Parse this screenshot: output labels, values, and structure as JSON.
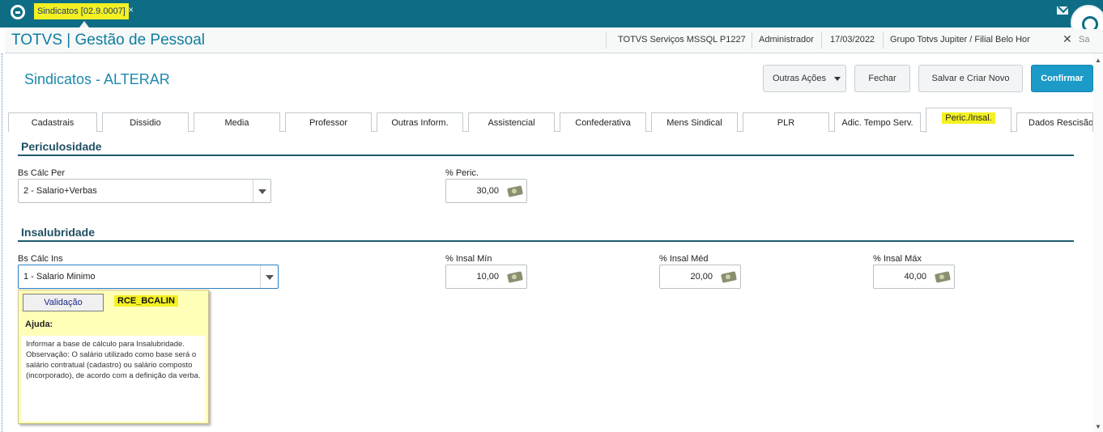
{
  "topbar": {
    "tab_label": "Sindicatos [02.9.0007]",
    "tab_close": "×"
  },
  "app": {
    "title": "TOTVS | Gestão de Pessoal",
    "env": "TOTVS Serviços MSSQL P1227",
    "user": "Administrador",
    "date": "17/03/2022",
    "branch": "Grupo Totvs Jupiter / Filial Belo Hor",
    "close_icon": "✕",
    "close_label": "Sa"
  },
  "form": {
    "title": "Sindicatos - ALTERAR",
    "buttons": {
      "outras": "Outras Ações",
      "fechar": "Fechar",
      "salvar": "Salvar e Criar Novo",
      "confirmar": "Confirmar"
    }
  },
  "tabs": [
    "Cadastrais",
    "Dissidio",
    "Media",
    "Professor",
    "Outras Inform.",
    "Assistencial",
    "Confederativa",
    "Mens Sindical",
    "PLR",
    "Adic. Tempo Serv.",
    "Peric./Insal.",
    "Dados Rescisão"
  ],
  "periculosidade": {
    "title": "Periculosidade",
    "bs_label": "Bs Cálc Per",
    "bs_value": "2 - Salario+Verbas",
    "perc_label": "% Peric.",
    "perc_value": "30,00"
  },
  "insalubridade": {
    "title": "Insalubridade",
    "bs_label": "Bs Cálc Ins",
    "bs_value": "1 - Salario Minimo",
    "min_label": "% Insal Mín",
    "min_value": "10,00",
    "med_label": "% Insal Méd",
    "med_value": "20,00",
    "max_label": "% Insal Máx",
    "max_value": "40,00"
  },
  "tooltip": {
    "validacao": "Validação",
    "code": "RCE_BCALIN",
    "ajuda": "Ajuda:",
    "help_text": "Informar a base de cálculo para Insalubridade. Observação:  O salário utilizado como base será o salário contratual (cadastro) ou salário composto (incorporado), de acordo com a definição da verba."
  }
}
